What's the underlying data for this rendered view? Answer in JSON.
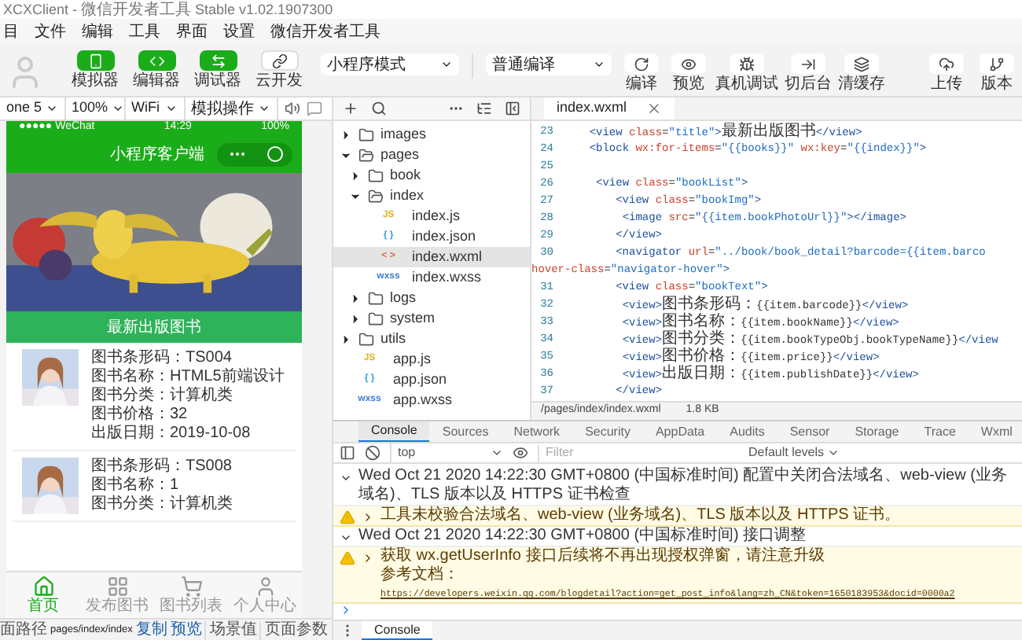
{
  "window": {
    "title": "XCXClient - 微信开发者工具 Stable v1.02.1907300"
  },
  "menu": [
    "目",
    "文件",
    "编辑",
    "工具",
    "界面",
    "设置",
    "微信开发者工具"
  ],
  "toolbar": {
    "modes": [
      {
        "label": "模拟器",
        "kind": "simulator",
        "on": true
      },
      {
        "label": "编辑器",
        "kind": "editor",
        "on": true
      },
      {
        "label": "调试器",
        "kind": "debugger",
        "on": true
      },
      {
        "label": "云开发",
        "kind": "cloud",
        "on": false
      }
    ],
    "mode_select": "小程序模式",
    "compile_select": "普通编译",
    "actions": [
      {
        "label": "编译",
        "kind": "compile"
      },
      {
        "label": "预览",
        "kind": "preview"
      },
      {
        "label": "真机调试",
        "kind": "device"
      },
      {
        "label": "切后台",
        "kind": "background"
      },
      {
        "label": "清缓存",
        "kind": "cache"
      }
    ],
    "right_actions": [
      {
        "label": "上传",
        "kind": "upload"
      },
      {
        "label": "版本",
        "kind": "version"
      }
    ]
  },
  "simulator": {
    "device": "one 5",
    "zoom": "100%",
    "network": "WiFi",
    "operations": "模拟操作",
    "phone_status": {
      "carrier": "●●●●● WeChat",
      "time": "14:29",
      "battery": "100%"
    },
    "nav_title": "小程序客户端",
    "banner": "最新出版图书",
    "books": [
      {
        "lines": [
          "图书条形码：TS004",
          "图书名称：HTML5前端设计",
          "图书分类：计算机类",
          "图书价格：32",
          "出版日期：2019-10-08"
        ]
      },
      {
        "lines": [
          "图书条形码：TS008",
          "图书名称：1",
          "图书分类：计算机类"
        ]
      }
    ],
    "tabbar": [
      {
        "label": "首页",
        "kind": "home",
        "selected": true
      },
      {
        "label": "发布图书",
        "kind": "publish",
        "selected": false
      },
      {
        "label": "图书列表",
        "kind": "cart",
        "selected": false
      },
      {
        "label": "个人中心",
        "kind": "user",
        "selected": false
      }
    ]
  },
  "status_bar": {
    "path_label": "面路径",
    "path": "pages/index/index",
    "links": [
      "复制",
      "预览"
    ],
    "scene": "场景值",
    "params": "页面参数"
  },
  "explorer": {
    "tree": [
      {
        "name": "images",
        "kind": "folder",
        "expanded": false,
        "selected": false
      },
      {
        "name": "pages",
        "kind": "folder",
        "expanded": true,
        "selected": false,
        "children": [
          {
            "name": "book",
            "kind": "folder",
            "expanded": false,
            "selected": false
          },
          {
            "name": "index",
            "kind": "folder",
            "expanded": true,
            "selected": false,
            "children": [
              {
                "name": "index.js",
                "kind": "file",
                "badge": "JS",
                "selected": false
              },
              {
                "name": "index.json",
                "kind": "file",
                "badge": "{ }",
                "selected": false
              },
              {
                "name": "index.wxml",
                "kind": "file",
                "badge": "< >",
                "selected": true
              },
              {
                "name": "index.wxss",
                "kind": "file",
                "badge": "wxss",
                "selected": false
              }
            ]
          },
          {
            "name": "logs",
            "kind": "folder",
            "expanded": false,
            "selected": false
          },
          {
            "name": "system",
            "kind": "folder",
            "expanded": false,
            "selected": false
          }
        ]
      },
      {
        "name": "utils",
        "kind": "folder",
        "expanded": false,
        "selected": false
      },
      {
        "name": "app.js",
        "kind": "file",
        "badge": "JS",
        "selected": false
      },
      {
        "name": "app.json",
        "kind": "file",
        "badge": "{ }",
        "selected": false
      },
      {
        "name": "app.wxss",
        "kind": "file",
        "badge": "wxss",
        "selected": false
      }
    ]
  },
  "editor": {
    "tab": "index.wxml",
    "lines": [
      {
        "n": "23",
        "code": "    <view class=\"title\">最新出版图书</view>"
      },
      {
        "n": "24",
        "code": "    <block wx:for-items=\"{{books}}\" wx:key=\"{{index}}\">"
      },
      {
        "n": "25"
      },
      {
        "n": "26",
        "code": "     <view class=\"bookList\">"
      },
      {
        "n": "27",
        "code": "        <view class=\"bookImg\">"
      },
      {
        "n": "28",
        "code": "         <image src=\"{{item.bookPhotoUrl}}\"></image>"
      },
      {
        "n": "29",
        "code": "        </view>"
      },
      {
        "n": "30",
        "code": "        <navigator url=\"../book/book_detail?barcode={{item.barco",
        "wrap": "hover-class=\"navigator-hover\">"
      },
      {
        "n": "31",
        "code": "        <view class=\"bookText\">"
      },
      {
        "n": "32",
        "code": "         <view>图书条形码：{{item.barcode}}</view>"
      },
      {
        "n": "33",
        "code": "         <view>图书名称：{{item.bookName}}</view>"
      },
      {
        "n": "34",
        "code": "         <view>图书分类：{{item.bookTypeObj.bookTypeName}}</view"
      },
      {
        "n": "35",
        "code": "         <view>图书价格：{{item.price}}</view>"
      },
      {
        "n": "36",
        "code": "         <view>出版日期：{{item.publishDate}}</view>"
      },
      {
        "n": "37",
        "code": "        </view>"
      }
    ],
    "path": "/pages/index/index.wxml",
    "size": "1.8 KB"
  },
  "devtools": {
    "tabs": [
      {
        "label": "Console",
        "selected": true
      },
      {
        "label": "Sources",
        "selected": false
      },
      {
        "label": "Network",
        "selected": false
      },
      {
        "label": "Security",
        "selected": false
      },
      {
        "label": "AppData",
        "selected": false
      },
      {
        "label": "Audits",
        "selected": false
      },
      {
        "label": "Sensor",
        "selected": false
      },
      {
        "label": "Storage",
        "selected": false
      },
      {
        "label": "Trace",
        "selected": false
      },
      {
        "label": "Wxml",
        "selected": false
      }
    ],
    "context": "top",
    "filter_placeholder": "Filter",
    "levels": "Default levels",
    "messages": [
      {
        "kind": "group",
        "text": "Wed Oct 21 2020 14:22:30 GMT+0800 (中国标准时间) 配置中关闭合法域名、web-view (业务域名)、TLS 版本以及 HTTPS 证书检查"
      },
      {
        "kind": "warning",
        "text": "工具未校验合法域名、web-view (业务域名)、TLS 版本以及 HTTPS 证书。"
      },
      {
        "kind": "group",
        "text": "Wed Oct 21 2020 14:22:30 GMT+0800 (中国标准时间) 接口调整"
      },
      {
        "kind": "warning",
        "text": "获取 wx.getUserInfo 接口后续将不再出现授权弹窗，请注意升级",
        "doc_label": "参考文档：",
        "link": "https://developers.weixin.qq.com/blogdetail?action=get_post_info&lang=zh_CN&token=1650183953&docid=0000a2"
      }
    ],
    "drawer_tab": "Console"
  }
}
